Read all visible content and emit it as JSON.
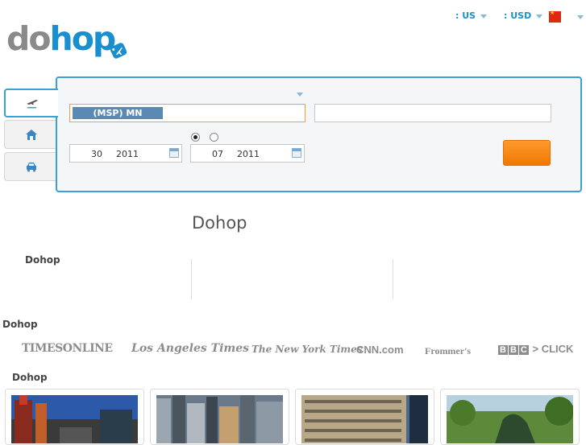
{
  "brand": {
    "logo_do": "do",
    "logo_hop": "hop"
  },
  "header": {
    "country": ": US",
    "currency": ": USD",
    "language_flag_icon": "china-flag-icon"
  },
  "tabs": [
    {
      "name": "flights",
      "icon": "airplane-icon",
      "active": true
    },
    {
      "name": "hotels",
      "icon": "house-icon",
      "active": false
    },
    {
      "name": "cars",
      "icon": "car-icon",
      "active": false
    }
  ],
  "search": {
    "from_value": "(MSP) MN",
    "to_value": "",
    "depart": {
      "day": "30",
      "year": "2011"
    },
    "return": {
      "day": "07",
      "year": "2011"
    },
    "trip_type_selected": "one-way",
    "search_label": ""
  },
  "content": {
    "main_title": "Dohop",
    "section_1_title": "Dohop",
    "press_title": "Dohop",
    "destinations_title": "Dohop"
  },
  "press": {
    "times_online": "TIMESONLINE",
    "la_times": "Los Angeles Times",
    "nyt": "The New York Times",
    "cnn": "CNN.com",
    "frommers": "Frommer's",
    "bbc_1": "B",
    "bbc_2": "B",
    "bbc_3": "C",
    "bbc_click": "> CLICK"
  },
  "colors": {
    "accent_blue": "#1a8fd0",
    "panel_border": "#3aa0d6",
    "search_button": "#f07800",
    "selection": "#5a89b4"
  }
}
